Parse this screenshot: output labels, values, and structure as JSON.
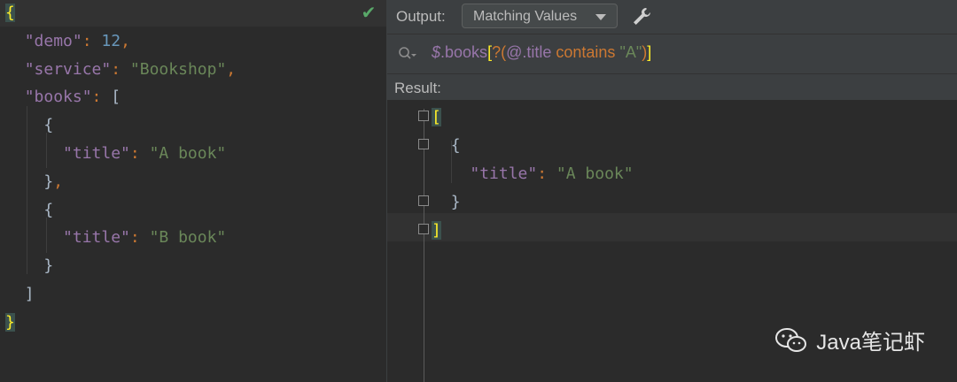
{
  "editor": {
    "lines": [
      {
        "indent": "",
        "parts": [
          {
            "t": "{",
            "c": "brace-hl"
          }
        ]
      },
      {
        "indent": "  ",
        "parts": [
          {
            "t": "\"demo\"",
            "c": "key"
          },
          {
            "t": ": ",
            "c": "pun"
          },
          {
            "t": "12",
            "c": "num"
          },
          {
            "t": ",",
            "c": "pun"
          }
        ]
      },
      {
        "indent": "  ",
        "parts": [
          {
            "t": "\"service\"",
            "c": "key"
          },
          {
            "t": ": ",
            "c": "pun"
          },
          {
            "t": "\"Bookshop\"",
            "c": "str"
          },
          {
            "t": ",",
            "c": "pun"
          }
        ]
      },
      {
        "indent": "  ",
        "parts": [
          {
            "t": "\"books\"",
            "c": "key"
          },
          {
            "t": ": ",
            "c": "pun"
          },
          {
            "t": "[",
            "c": ""
          }
        ]
      },
      {
        "indent": "    ",
        "parts": [
          {
            "t": "{",
            "c": ""
          }
        ]
      },
      {
        "indent": "      ",
        "parts": [
          {
            "t": "\"title\"",
            "c": "key"
          },
          {
            "t": ": ",
            "c": "pun"
          },
          {
            "t": "\"A book\"",
            "c": "str"
          }
        ]
      },
      {
        "indent": "    ",
        "parts": [
          {
            "t": "}",
            "c": ""
          },
          {
            "t": ",",
            "c": "pun"
          }
        ]
      },
      {
        "indent": "    ",
        "parts": [
          {
            "t": "{",
            "c": ""
          }
        ]
      },
      {
        "indent": "      ",
        "parts": [
          {
            "t": "\"title\"",
            "c": "key"
          },
          {
            "t": ": ",
            "c": "pun"
          },
          {
            "t": "\"B book\"",
            "c": "str"
          }
        ]
      },
      {
        "indent": "    ",
        "parts": [
          {
            "t": "}",
            "c": ""
          }
        ]
      },
      {
        "indent": "  ",
        "parts": [
          {
            "t": "]",
            "c": ""
          }
        ]
      },
      {
        "indent": "",
        "parts": [
          {
            "t": "}",
            "c": "brace-hl"
          }
        ]
      }
    ]
  },
  "toolbar": {
    "output_label": "Output:",
    "output_mode": "Matching Values",
    "settings_icon": "wrench-icon",
    "status_icon": "checkmark-icon"
  },
  "filter": {
    "query_parts": [
      {
        "t": "$",
        "c": "q-dollar"
      },
      {
        "t": ".books",
        "c": "q-path"
      },
      {
        "t": "[",
        "c": "q-bracket"
      },
      {
        "t": "?(",
        "c": "q-op"
      },
      {
        "t": "@",
        "c": "q-path"
      },
      {
        "t": ".title",
        "c": "q-path"
      },
      {
        "t": " contains ",
        "c": "q-op"
      },
      {
        "t": "\"A\"",
        "c": "q-str"
      },
      {
        "t": ")",
        "c": "q-op"
      },
      {
        "t": "]",
        "c": "q-bracket"
      }
    ]
  },
  "result": {
    "label": "Result:",
    "lines": [
      {
        "indent": "",
        "parts": [
          {
            "t": "[",
            "c": "brace-hl"
          }
        ]
      },
      {
        "indent": "  ",
        "parts": [
          {
            "t": "{",
            "c": ""
          }
        ]
      },
      {
        "indent": "    ",
        "parts": [
          {
            "t": "\"title\"",
            "c": "key"
          },
          {
            "t": ": ",
            "c": "pun"
          },
          {
            "t": "\"A book\"",
            "c": "str"
          }
        ]
      },
      {
        "indent": "  ",
        "parts": [
          {
            "t": "}",
            "c": ""
          }
        ]
      },
      {
        "indent": "",
        "parts": [
          {
            "t": "]",
            "c": "brace-hl"
          }
        ]
      }
    ]
  },
  "watermark": {
    "text": "Java笔记虾",
    "icon": "wechat-icon"
  },
  "colors": {
    "background": "#2b2b2b",
    "panel": "#3c3f41",
    "key": "#9876aa",
    "string": "#6a8759",
    "number": "#6897bb",
    "keyword": "#cc7832",
    "bracket_highlight": "#ffef28"
  }
}
